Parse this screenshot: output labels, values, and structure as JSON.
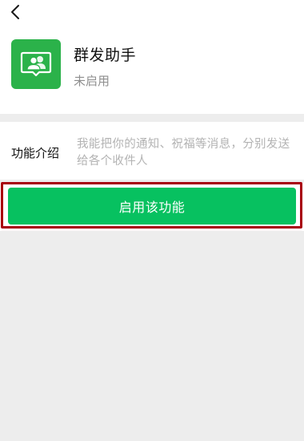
{
  "header": {
    "back_icon": "chevron-left-icon"
  },
  "app": {
    "name": "群发助手",
    "status": "未启用",
    "icon": "group-message-icon",
    "icon_color": "#2bb24a"
  },
  "intro": {
    "label": "功能介绍",
    "text": "我能把你的通知、祝福等消息，分别发送给各个收件人"
  },
  "actions": {
    "enable_label": "启用该功能",
    "enable_color": "#07c160",
    "highlight_color": "#a8000e"
  }
}
